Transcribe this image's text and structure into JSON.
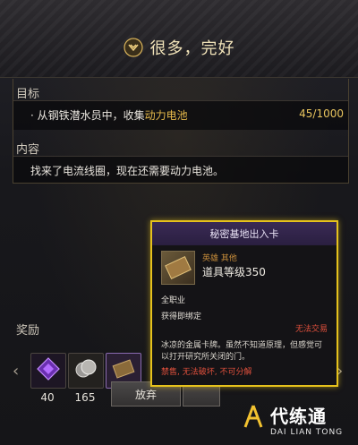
{
  "dialog": {
    "title": "很多，完好",
    "title_icon": "crest-icon"
  },
  "objective": {
    "label": "目标",
    "bullet": "·",
    "text_prefix": "从钢铁潜水员中，收集",
    "text_highlight": "动力电池",
    "progress": "45/1000"
  },
  "content": {
    "label": "内容",
    "text": "找来了电流线圈，现在还需要动力电池。"
  },
  "rewards": {
    "label": "奖励",
    "items": [
      {
        "icon": "purple-crystal-icon",
        "count": "40"
      },
      {
        "icon": "silver-coin-icon",
        "count": "165"
      },
      {
        "icon": "card-icon",
        "count": ""
      }
    ]
  },
  "buttons": {
    "give_up": "放弃"
  },
  "tooltip": {
    "title": "秘密基地出入卡",
    "grade": "英雄 其他",
    "item_level": "道具等级350",
    "class": "全职业",
    "bind": "获得即绑定",
    "untradeable": "无法交易",
    "description": "冰凉的金属卡牌。虽然不知道原理，但感觉可以打开研究所关闭的门。",
    "restriction": "禁售, 无法破坏, 不可分解"
  },
  "watermark": {
    "main": "代练通",
    "sub": "DAI LIAN TONG"
  },
  "colors": {
    "accent_gold": "#e6c21c",
    "highlight": "#e4b84a",
    "warning": "#e0503c"
  }
}
